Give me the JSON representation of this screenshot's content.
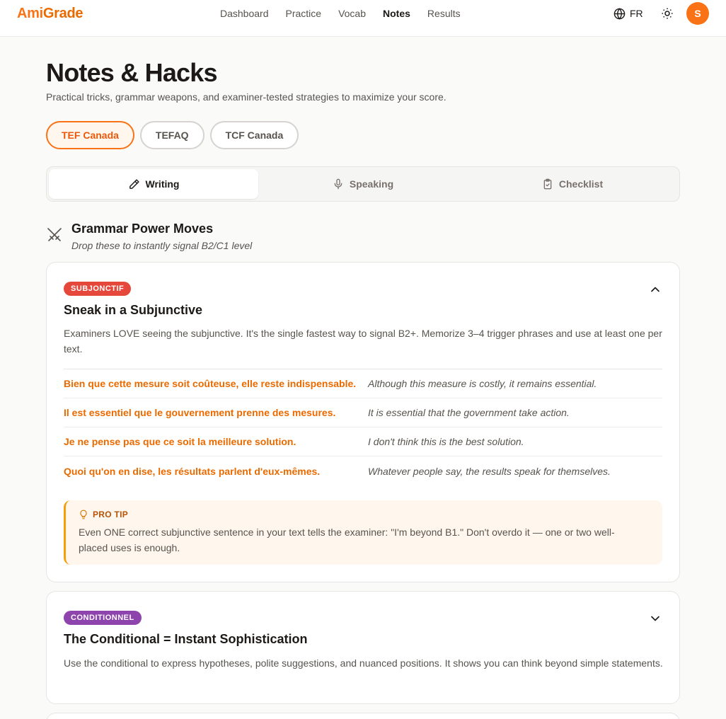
{
  "header": {
    "logo_part1": "Ami",
    "logo_part2": "Grade",
    "nav": [
      {
        "label": "Dashboard",
        "active": false
      },
      {
        "label": "Practice",
        "active": false
      },
      {
        "label": "Vocab",
        "active": false
      },
      {
        "label": "Notes",
        "active": true
      },
      {
        "label": "Results",
        "active": false
      }
    ],
    "language": "FR",
    "avatar_initial": "S"
  },
  "page": {
    "title": "Notes & Hacks",
    "subtitle": "Practical tricks, grammar weapons, and examiner-tested strategies to maximize your score."
  },
  "exam_tabs": [
    {
      "label": "TEF Canada",
      "active": true
    },
    {
      "label": "TEFAQ",
      "active": false
    },
    {
      "label": "TCF Canada",
      "active": false
    }
  ],
  "section_tabs": [
    {
      "label": "Writing",
      "icon": "pencil-icon",
      "active": true
    },
    {
      "label": "Speaking",
      "icon": "microphone-icon",
      "active": false
    },
    {
      "label": "Checklist",
      "icon": "clipboard-check-icon",
      "active": false
    }
  ],
  "section": {
    "icon": "crossed-swords-icon",
    "title": "Grammar Power Moves",
    "subtitle": "Drop these to instantly signal B2/C1 level"
  },
  "cards": [
    {
      "badge": "SUBJONCTIF",
      "badge_color": "#e5483b",
      "expanded": true,
      "title": "Sneak in a Subjunctive",
      "description": "Examiners LOVE seeing the subjunctive. It's the single fastest way to signal B2+. Memorize 3–4 trigger phrases and use at least one per text.",
      "examples": [
        {
          "fr": "Bien que cette mesure soit coûteuse, elle reste indispensable.",
          "en": "Although this measure is costly, it remains essential."
        },
        {
          "fr": "Il est essentiel que le gouvernement prenne des mesures.",
          "en": "It is essential that the government take action."
        },
        {
          "fr": "Je ne pense pas que ce soit la meilleure solution.",
          "en": "I don't think this is the best solution."
        },
        {
          "fr": "Quoi qu'on en dise, les résultats parlent d'eux-mêmes.",
          "en": "Whatever people say, the results speak for themselves."
        }
      ],
      "tip_label": "PRO TIP",
      "tip_text": "Even ONE correct subjunctive sentence in your text tells the examiner: \"I'm beyond B1.\" Don't overdo it — one or two well-placed uses is enough."
    },
    {
      "badge": "CONDITIONNEL",
      "badge_color": "#8e44ad",
      "expanded": false,
      "title": "The Conditional = Instant Sophistication",
      "description": "Use the conditional to express hypotheses, polite suggestions, and nuanced positions. It shows you can think beyond simple statements."
    }
  ],
  "colors": {
    "accent": "#f97316",
    "accent_text": "#ea6a00",
    "tip_bg": "#fff7ed",
    "tip_border": "#f59e0b"
  }
}
